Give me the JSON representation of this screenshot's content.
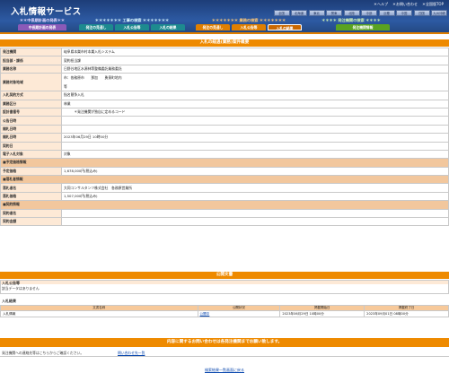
{
  "header": {
    "logo": "入札情報サービス",
    "links": [
      "＊ヘルプ",
      "＊お問い合わせ",
      "＊全国版TOP"
    ],
    "prefectures": [
      "全国",
      "北海道",
      "東北",
      "関東",
      "北陸",
      "中部",
      "近畿",
      "中国",
      "四国",
      "九州沖縄"
    ]
  },
  "nav": {
    "groups": [
      {
        "title": "＊＊中長期計画の発表＊＊",
        "items": [
          "中長期計画の発表"
        ],
        "theme": "purple"
      },
      {
        "title": "＊＊＊＊＊＊＊ 工事の検索 ＊＊＊＊＊＊＊",
        "items": [
          "発注の見通し",
          "入札公告等",
          "入札の結果"
        ],
        "theme": "teal"
      },
      {
        "title": "＊＊＊＊＊＊＊ 業務の検索 ＊＊＊＊＊＊＊",
        "items": [
          "発注の見通し",
          "入札公告等",
          "入札の結果"
        ],
        "theme": "orange",
        "active": 2
      },
      {
        "title": "＊＊＊＊ 発注機関の検索 ＊＊＊＊",
        "items": [
          "発注機関情報"
        ],
        "theme": "green"
      }
    ]
  },
  "main": {
    "title": "入札の経過(業務)案件概要",
    "rows": [
      {
        "label": "発注機関",
        "value": "岐阜県本巣市村本巣入札システム"
      },
      {
        "label": "担当部・課係",
        "value": "契約担当課"
      },
      {
        "label": "業務名称",
        "value": "日野谷地区水源林等整備委託業務委託"
      },
      {
        "label": "業務対象地域",
        "value": "市：各務原市　　那加　　勇泉町地内",
        "value2": "等"
      },
      {
        "label": "入札契約方式",
        "value": "指名競争入札"
      },
      {
        "label": "業務区分",
        "value": "林業"
      },
      {
        "label": "設計書番号",
        "value": "　　　＊発注機関が独自に定めるコード"
      },
      {
        "label": "公告日時",
        "value": ""
      },
      {
        "label": "開札日時",
        "value": ""
      },
      {
        "label": "開札日時",
        "value": "2023年06月29日 10時00分"
      },
      {
        "label": "契約日",
        "value": ""
      },
      {
        "label": "電子入札対象",
        "value": "対象"
      },
      {
        "group": "■予定価格情報"
      },
      {
        "label": "予定価格",
        "value": "1,678,000円(税込み)"
      },
      {
        "group": "■落札者情報"
      },
      {
        "label": "落札者名",
        "value": "大同コンサルタンツ株式会社　各務原営業所"
      },
      {
        "label": "落札価格",
        "value": "1,507,000円(税込み)"
      },
      {
        "group": "■契約情報"
      },
      {
        "label": "契約者名",
        "value": ""
      },
      {
        "label": "契約金額",
        "value": ""
      }
    ]
  },
  "docs": {
    "title": "公開文書",
    "notice_head": "入札公告等",
    "notice_text": "該当データはありません",
    "results_head": "入札結果",
    "columns": [
      "文書名称",
      "公開状況",
      "掲載開始日",
      "掲載終了日"
    ],
    "rows": [
      {
        "name": "入札情報",
        "status": "公開中",
        "start": "2023年06月29日 10時00分",
        "end": "2023年09月01日 08時00分"
      }
    ]
  },
  "contact": {
    "title": "内容に関するお問い合わせは各発注機関までお願い致します。",
    "text": "発注機関への連絡先等はこちらからご確認ください。",
    "link": "問い合わせ先一覧"
  },
  "footer": {
    "link": "検索結果一覧画面に戻る"
  }
}
